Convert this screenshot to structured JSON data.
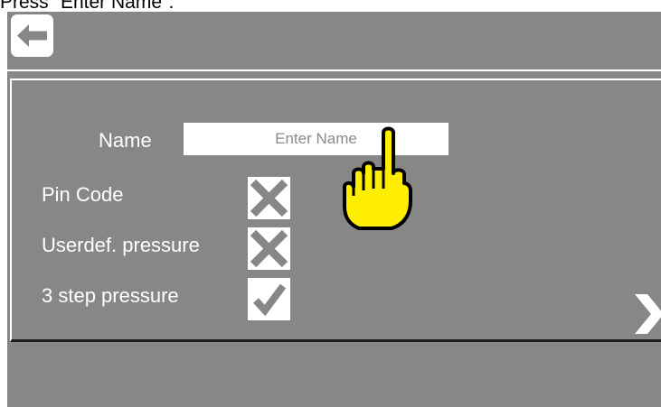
{
  "caption": "Press \"Enter Name\".",
  "form": {
    "name_label": "Name",
    "name_placeholder": "Enter Name",
    "pin_code_label": "Pin Code",
    "pin_code_enabled": false,
    "userdef_pressure_label": "Userdef. pressure",
    "userdef_pressure_enabled": false,
    "step_pressure_label": "3 step pressure",
    "step_pressure_enabled": true
  },
  "icons": {
    "back": "arrow-left-icon",
    "next": "chevron-right-icon",
    "pointer": "pointing-hand-icon"
  },
  "colors": {
    "screen_bg": "#878787",
    "hand_fill": "#ffee00",
    "hand_outline": "#000000"
  }
}
